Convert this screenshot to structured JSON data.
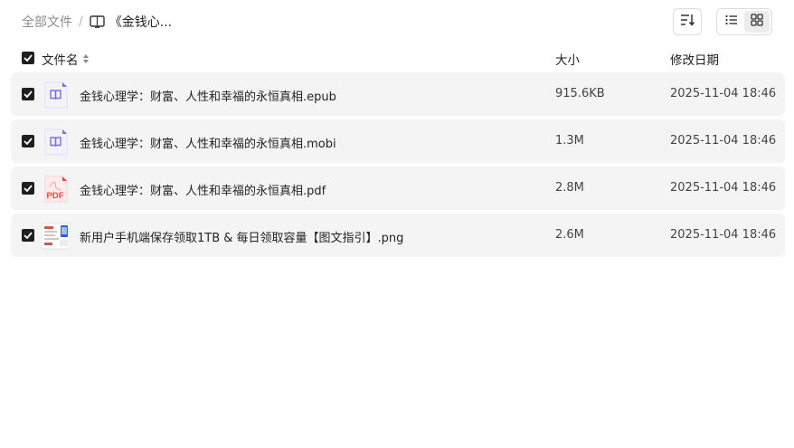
{
  "breadcrumb": {
    "root": "全部文件",
    "separator": "/",
    "current": "《金钱心..."
  },
  "toolbar": {
    "sort_icon": "sort-lines-icon",
    "list_view_icon": "list-view-icon",
    "grid_view_icon": "grid-view-icon",
    "active_view": "list"
  },
  "table": {
    "headers": {
      "name": "文件名",
      "size": "大小",
      "date": "修改日期"
    },
    "rows": [
      {
        "name": "金钱心理学：财富、人性和幸福的永恒真相.epub",
        "size": "915.6KB",
        "date": "2025-11-04 18:46",
        "type": "ebook",
        "checked": true
      },
      {
        "name": "金钱心理学：财富、人性和幸福的永恒真相.mobi",
        "size": "1.3M",
        "date": "2025-11-04 18:46",
        "type": "ebook",
        "checked": true
      },
      {
        "name": "金钱心理学：财富、人性和幸福的永恒真相.pdf",
        "size": "2.8M",
        "date": "2025-11-04 18:46",
        "type": "pdf",
        "checked": true
      },
      {
        "name": "新用户手机端保存领取1TB & 每日领取容量【图文指引】.png",
        "size": "2.6M",
        "date": "2025-11-04 18:46",
        "type": "image",
        "checked": true
      }
    ]
  },
  "colors": {
    "row_bg": "#f4f4f4",
    "checkbox": "#1f1f1f",
    "ebook_icon": "#7b6ee0",
    "pdf_icon": "#e5483b"
  }
}
